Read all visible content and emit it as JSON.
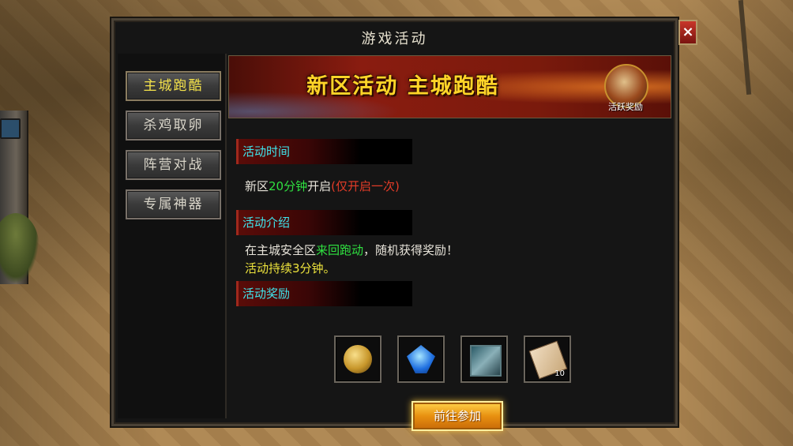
{
  "dialog": {
    "title": "游戏活动",
    "close_glyph": "×"
  },
  "tabs": [
    {
      "label": "主城跑酷",
      "active": true
    },
    {
      "label": "杀鸡取卵",
      "active": false
    },
    {
      "label": "阵营对战",
      "active": false
    },
    {
      "label": "专属神器",
      "active": false
    }
  ],
  "banner": {
    "headline": "新区活动  主城跑酷",
    "badge_label": "活跃奖励",
    "badge_icon": "chest-icon"
  },
  "sections": {
    "time": {
      "heading": "活动时间",
      "prefix": "新区",
      "duration": "20分钟",
      "suffix": "开启",
      "note": "(仅开启一次)"
    },
    "intro": {
      "heading": "活动介绍",
      "line1_prefix": "在主城安全区",
      "line1_highlight": "来回跑动",
      "line1_suffix": "，随机获得奖励！",
      "line2": "活动持续3分钟。"
    },
    "rewards": {
      "heading": "活动奖励",
      "items": [
        {
          "icon": "gold-coin-icon"
        },
        {
          "icon": "blue-gem-icon"
        },
        {
          "icon": "shield-token-icon"
        },
        {
          "icon": "scroll-icon",
          "quantity": "10"
        }
      ]
    }
  },
  "join_button": "前往参加",
  "colors": {
    "accent_cyan": "#3fe6ee",
    "highlight_green": "#2fe040",
    "warning_red": "#e43c28",
    "active_tab_yellow": "#f4e24a",
    "banner_gold": "#ffd528"
  }
}
